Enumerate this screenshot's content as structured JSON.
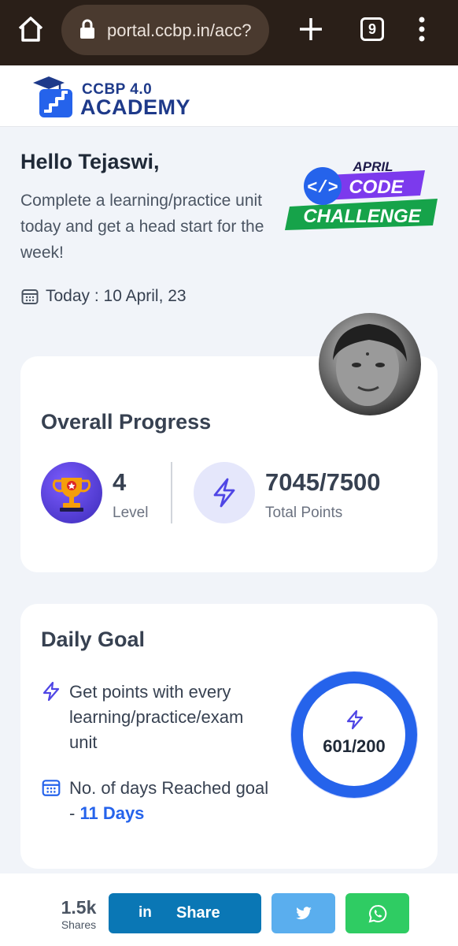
{
  "browser": {
    "url": "portal.ccbp.in/acc?",
    "tab_count": "9"
  },
  "header": {
    "logo_line1": "CCBP 4.0",
    "logo_line2": "ACADEMY"
  },
  "greeting": {
    "hello": "Hello Tejaswi,",
    "subtitle": "Complete a learning/practice unit today and get a head start for the week!",
    "today": "Today : 10 April, 23"
  },
  "challenge": {
    "month": "APRIL",
    "code": "CODE",
    "challenge": "CHALLENGE"
  },
  "progress": {
    "title": "Overall Progress",
    "level_value": "4",
    "level_label": "Level",
    "points_value": "7045/7500",
    "points_label": "Total Points"
  },
  "daily_goal": {
    "title": "Daily Goal",
    "points_text": "Get points with every learning/practice/exam unit",
    "days_text": "No. of days Reached goal -",
    "days_value": "11 Days",
    "ring_value": "601/200"
  },
  "share": {
    "count": "1.5k",
    "count_label": "Shares",
    "linkedin_icon": "in",
    "linkedin_label": "Share"
  },
  "colors": {
    "brand_blue": "#1e3a8a",
    "accent_blue": "#2563eb",
    "linkedin": "#0a77b5",
    "twitter": "#5aaeee",
    "whatsapp": "#2fcc63"
  }
}
